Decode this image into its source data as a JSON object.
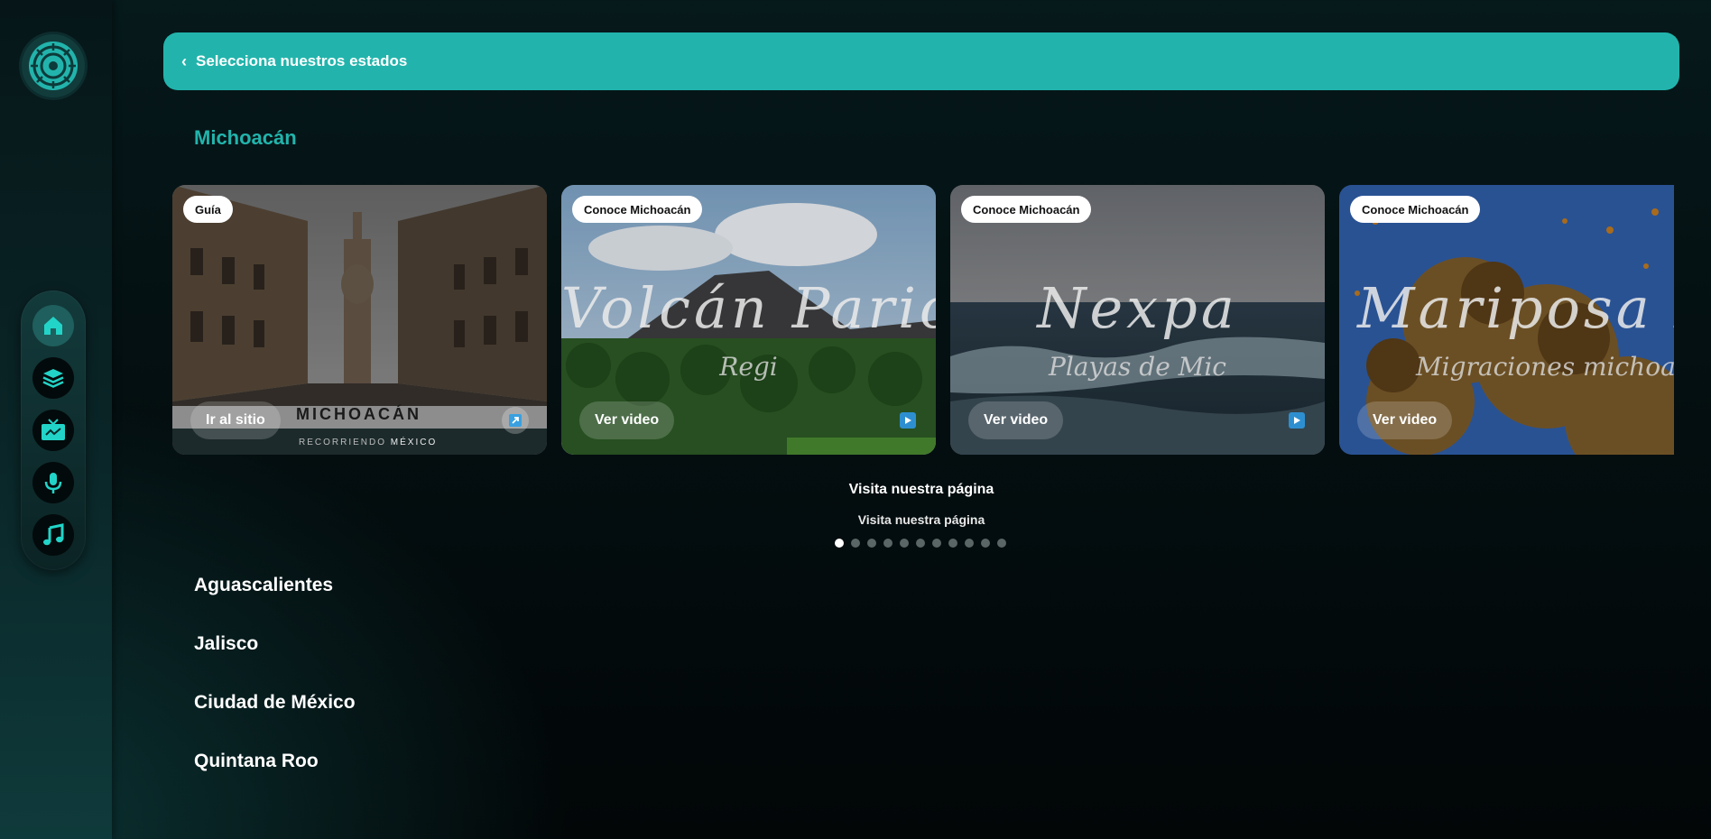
{
  "header": {
    "title": "Selecciona nuestros estados"
  },
  "current_state": "Michoacán",
  "cards": [
    {
      "badge": "Guía",
      "button": "Ir al sitio",
      "brand_name": "MICHOACÁN",
      "brand_sub_a": "RECORRIENDO",
      "brand_sub_b": "MÉXICO",
      "overlay_title": "",
      "overlay_sub": ""
    },
    {
      "badge": "Conoce Michoacán",
      "button": "Ver video",
      "overlay_title": "Volcán Paricutín",
      "overlay_sub": "Regi"
    },
    {
      "badge": "Conoce Michoacán",
      "button": "Ver video",
      "overlay_title": "Nexpa",
      "overlay_sub": "Playas de Mic"
    },
    {
      "badge": "Conoce Michoacán",
      "button": "Ver video",
      "overlay_title": "Mariposa Monarca",
      "overlay_sub": "Migraciones michoacan"
    }
  ],
  "carousel": {
    "caption_primary": "Visita nuestra página",
    "caption_secondary": "Visita nuestra página",
    "dots_total": 11,
    "active_dot_index": 0
  },
  "states": [
    "Aguascalientes",
    "Jalisco",
    "Ciudad de México",
    "Quintana Roo"
  ],
  "colors": {
    "accent": "#22b4ac",
    "background": "#041012"
  },
  "icons": {
    "logo": "aztec-sun-logo-icon",
    "nav": [
      "home-icon",
      "layers-icon",
      "tv-icon",
      "microphone-icon",
      "music-note-icon"
    ],
    "header": "chevron-left-icon",
    "card_guide": "external-link-icon",
    "card_video": "play-icon"
  }
}
